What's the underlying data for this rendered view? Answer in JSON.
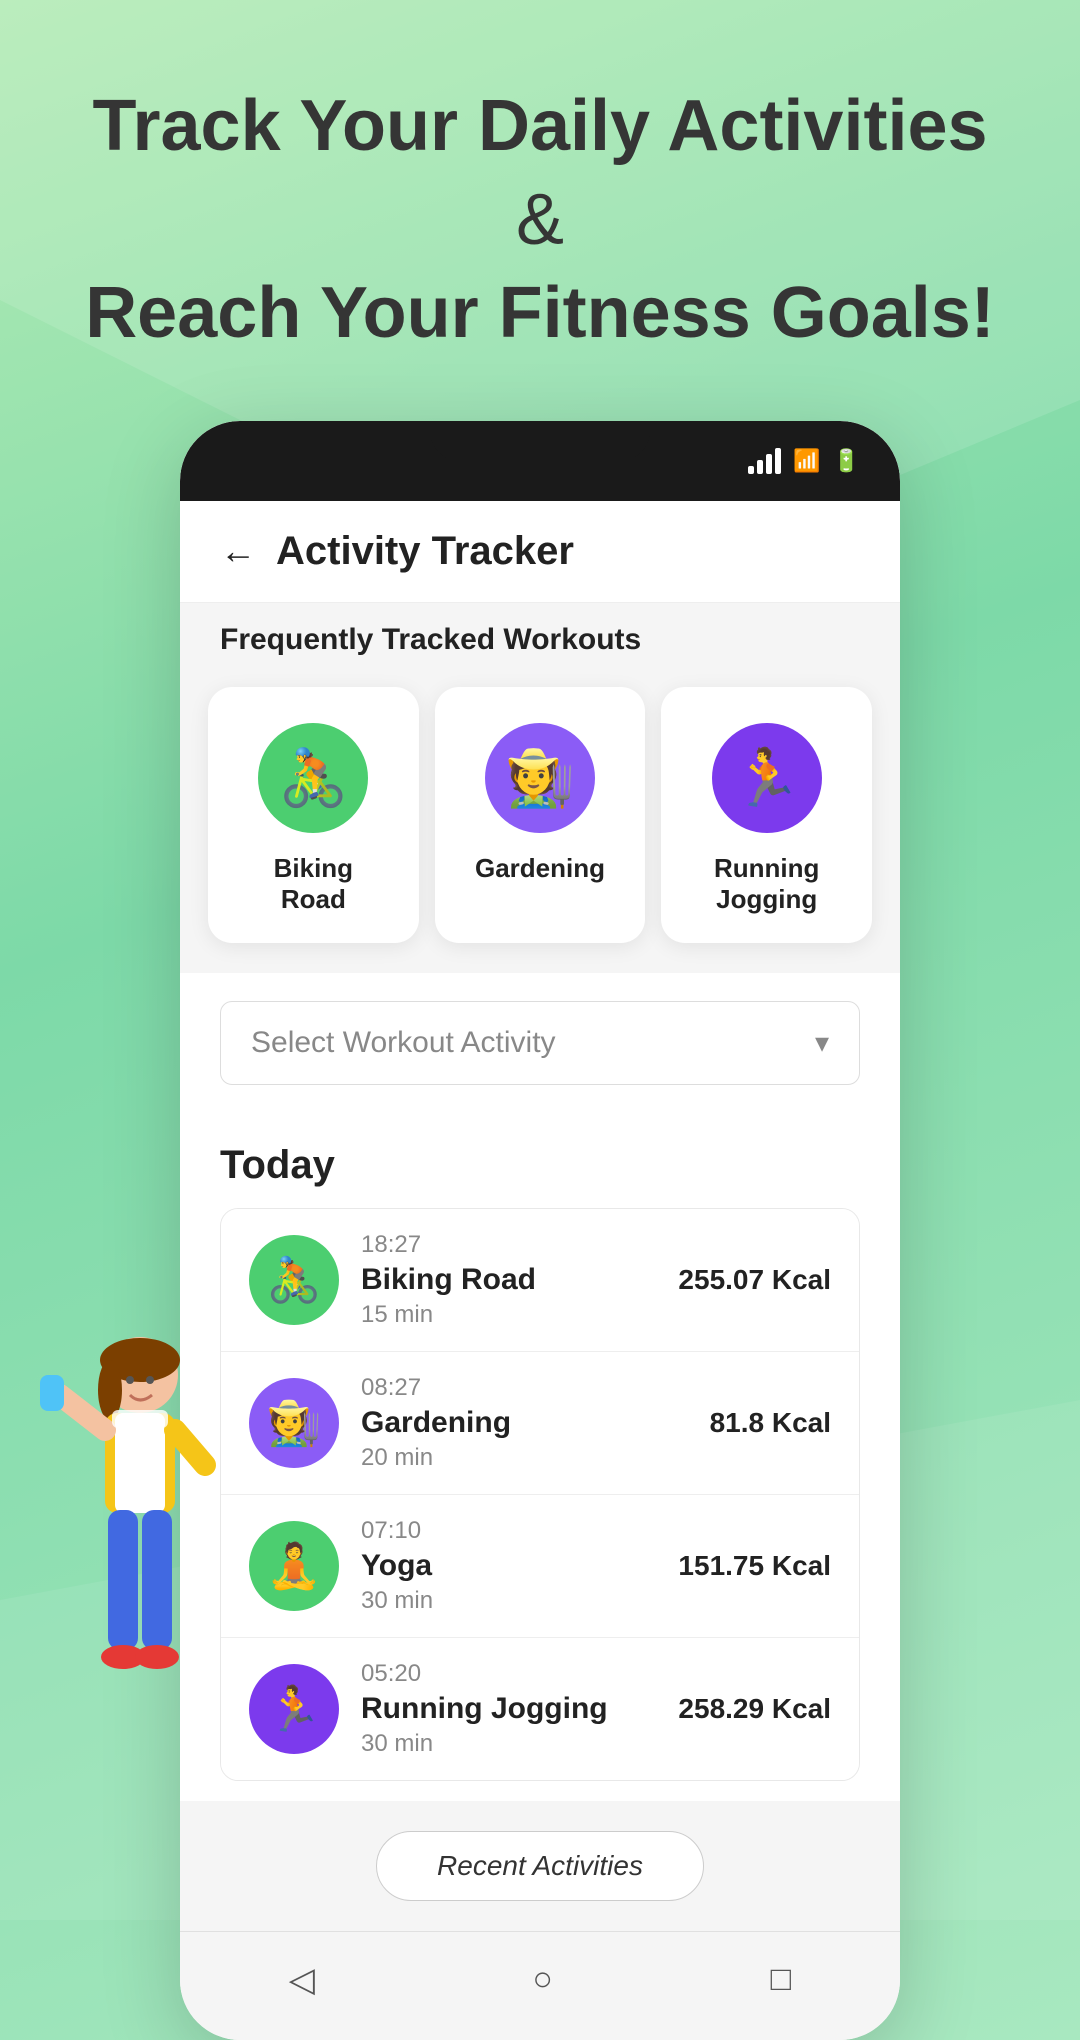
{
  "hero": {
    "line1_normal": "Track Your ",
    "line1_bold": "Daily Activities",
    "line1_end": " &",
    "line2_bold": "Reach Your Fitness Goals!"
  },
  "app": {
    "title": "Activity Tracker",
    "back_label": "←"
  },
  "frequently_tracked": {
    "label": "Frequently Tracked Workouts",
    "activities": [
      {
        "name": "Biking Road",
        "icon": "🚴",
        "bg": "icon-green"
      },
      {
        "name": "Gardening",
        "icon": "🧑‍🌾",
        "bg": "icon-purple"
      },
      {
        "name": "Running Jogging",
        "icon": "🏃",
        "bg": "icon-purple2"
      }
    ]
  },
  "dropdown": {
    "placeholder": "Select Workout Activity",
    "arrow": "▾"
  },
  "today": {
    "title": "Today",
    "items": [
      {
        "time": "18:27",
        "name": "Biking Road",
        "duration": "15 min",
        "kcal": "255.07 Kcal",
        "icon": "🚴",
        "bg": "icon-green"
      },
      {
        "time": "08:27",
        "name": "Gardening",
        "duration": "20 min",
        "kcal": "81.8 Kcal",
        "icon": "🧑‍🌾",
        "bg": "icon-purple"
      },
      {
        "time": "07:10",
        "name": "Yoga",
        "duration": "30 min",
        "kcal": "151.75 Kcal",
        "icon": "🧘",
        "bg": "icon-green"
      },
      {
        "time": "05:20",
        "name": "Running Jogging",
        "duration": "30 min",
        "kcal": "258.29 Kcal",
        "icon": "🏃",
        "bg": "icon-purple2"
      }
    ]
  },
  "recent_btn": {
    "label": "Recent Activities"
  },
  "bottom_nav": {
    "back": "◁",
    "home": "○",
    "square": "□"
  }
}
